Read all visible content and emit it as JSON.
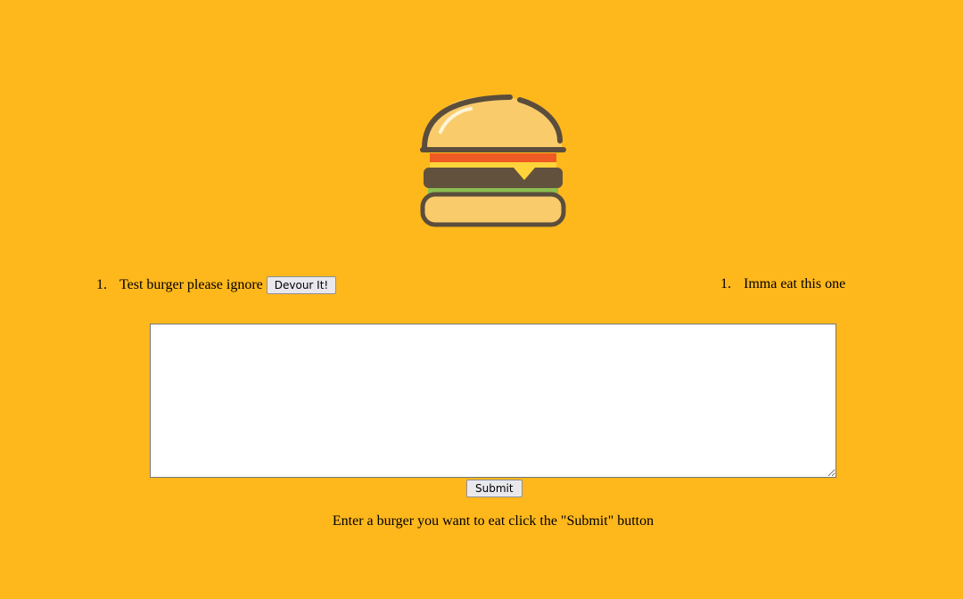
{
  "logo": {
    "icon": "burger-icon"
  },
  "uneaten_list": {
    "items": [
      {
        "number": "1.",
        "name": "Test burger please ignore",
        "button_label": "Devour It!"
      }
    ]
  },
  "devoured_list": {
    "items": [
      {
        "number": "1.",
        "name": "Imma eat this one"
      }
    ]
  },
  "form": {
    "textarea_value": "",
    "submit_label": "Submit",
    "instructions": "Enter a burger you want to eat click the \"Submit\" button"
  },
  "colors": {
    "background": "#ffb81c",
    "bun": "#f9cb6b",
    "outline": "#5b4d3c",
    "tomato": "#ef5a24",
    "patty": "#62513c",
    "lettuce": "#8bbd4f",
    "cheese": "#ffd43b"
  }
}
